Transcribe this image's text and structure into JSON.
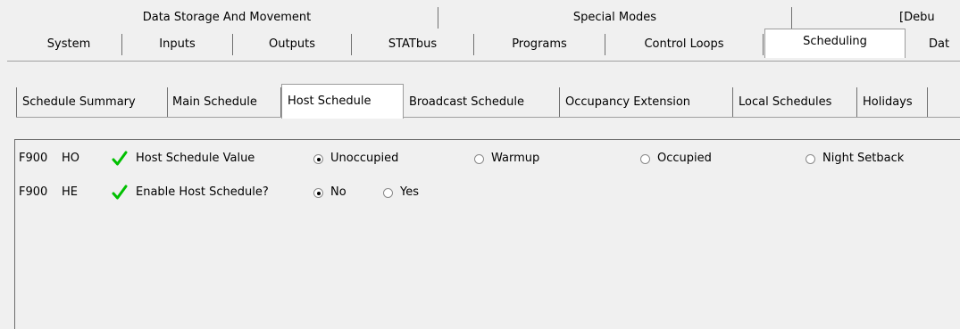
{
  "tabs_row1": [
    {
      "label": "Data Storage And Movement"
    },
    {
      "label": "Special Modes"
    },
    {
      "label": "[Debu"
    }
  ],
  "tabs_row2": [
    {
      "label": "System"
    },
    {
      "label": "Inputs"
    },
    {
      "label": "Outputs"
    },
    {
      "label": "STATbus"
    },
    {
      "label": "Programs"
    },
    {
      "label": "Control Loops"
    },
    {
      "label": "Scheduling",
      "active": true
    },
    {
      "label": "Dat"
    }
  ],
  "subtabs": [
    {
      "label": "Schedule Summary"
    },
    {
      "label": "Main Schedule"
    },
    {
      "label": "Host Schedule",
      "active": true
    },
    {
      "label": "Broadcast Schedule"
    },
    {
      "label": "Occupancy Extension"
    },
    {
      "label": "Local Schedules"
    },
    {
      "label": "Holidays"
    }
  ],
  "rows": [
    {
      "id": "F900",
      "code": "HO",
      "label": "Host Schedule Value",
      "options": [
        {
          "label": "Unoccupied",
          "selected": true
        },
        {
          "label": "Warmup",
          "selected": false
        },
        {
          "label": "Occupied",
          "selected": false
        },
        {
          "label": "Night Setback",
          "selected": false
        }
      ]
    },
    {
      "id": "F900",
      "code": "HE",
      "label": "Enable Host Schedule?",
      "options": [
        {
          "label": "No",
          "selected": true
        },
        {
          "label": "Yes",
          "selected": false
        }
      ]
    }
  ],
  "colors": {
    "check": "#00c000",
    "active_tab": "#ffffff",
    "background": "#f0f0f0"
  },
  "icons": {
    "status": "checkmark-icon",
    "option": "radio-button-icon"
  }
}
